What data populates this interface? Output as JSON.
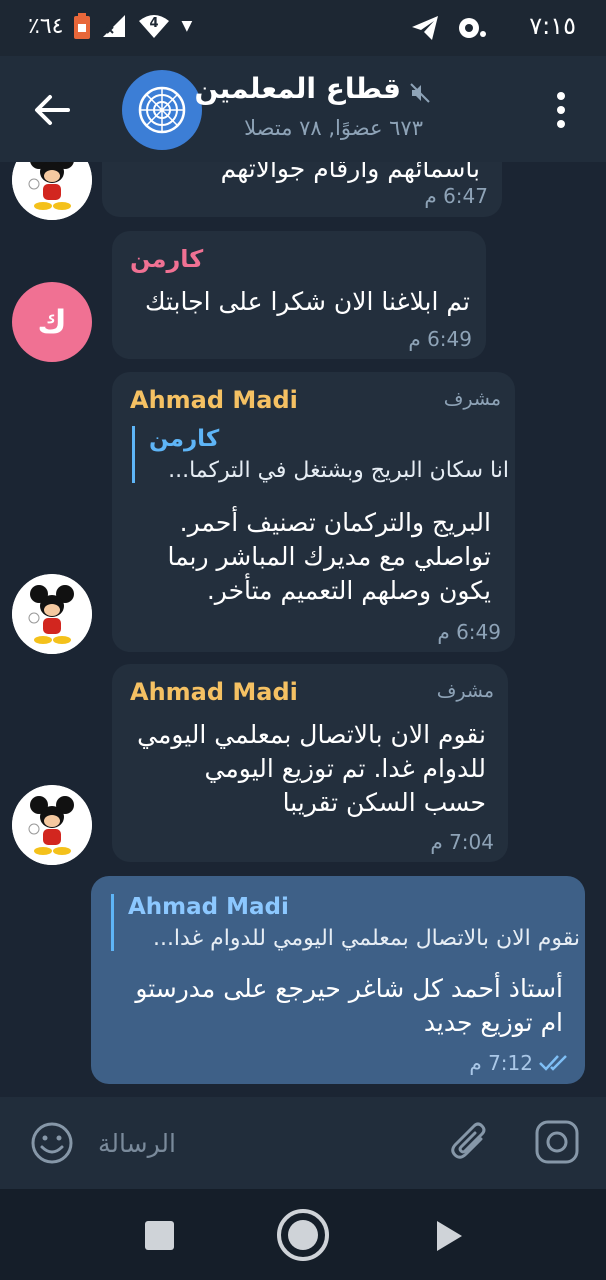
{
  "status_bar": {
    "time": "٧:١٥",
    "battery": "٪٦٤",
    "signal_badge": "4"
  },
  "header": {
    "title": "قطاع المعلمين",
    "subtitle": "٦٧٣ عضوًا, ٧٨ متصلا"
  },
  "messages": [
    {
      "partial_text": "باسمائهم وأرقام جوالاتهم",
      "time": "6:47 م"
    },
    {
      "sender": "كارمن",
      "avatar_letter": "ك",
      "text": "تم ابلاغنا الان شكرا على اجابتك",
      "time": "6:49 م"
    },
    {
      "sender": "Ahmad Madi",
      "role": "مشرف",
      "reply_name": "كارمن",
      "reply_text": "انا سكان البريج وبشتغل في التركما...",
      "lines": [
        "البريج والتركمان تصنيف أحمر.",
        "تواصلي مع مديرك المباشر ربما",
        "يكون وصلهم التعميم متأخر."
      ],
      "time": "6:49 م"
    },
    {
      "sender": "Ahmad Madi",
      "role": "مشرف",
      "lines": [
        "نقوم الان بالاتصال بمعلمي اليومي",
        "للدوام غدا. تم توزيع اليومي",
        "حسب السكن تقريبا"
      ],
      "time": "7:04 م"
    },
    {
      "reply_name": "Ahmad Madi",
      "reply_text": "نقوم الان بالاتصال بمعلمي اليومي للدوام غدا...",
      "lines": [
        "أستاذ أحمد  كل شاغر حيرجع على مدرستو",
        "ام توزيع جديد"
      ],
      "time": "7:12 م"
    }
  ],
  "input": {
    "placeholder": "الرسالة"
  },
  "colors": {
    "background": "#1b2533",
    "header": "#212d3b",
    "incoming_bubble": "#232f3d",
    "outgoing_bubble": "#3e6087",
    "admin_name": "#f5c163",
    "carmen_name": "#f07193",
    "reply_accent": "#5eb5f7"
  }
}
